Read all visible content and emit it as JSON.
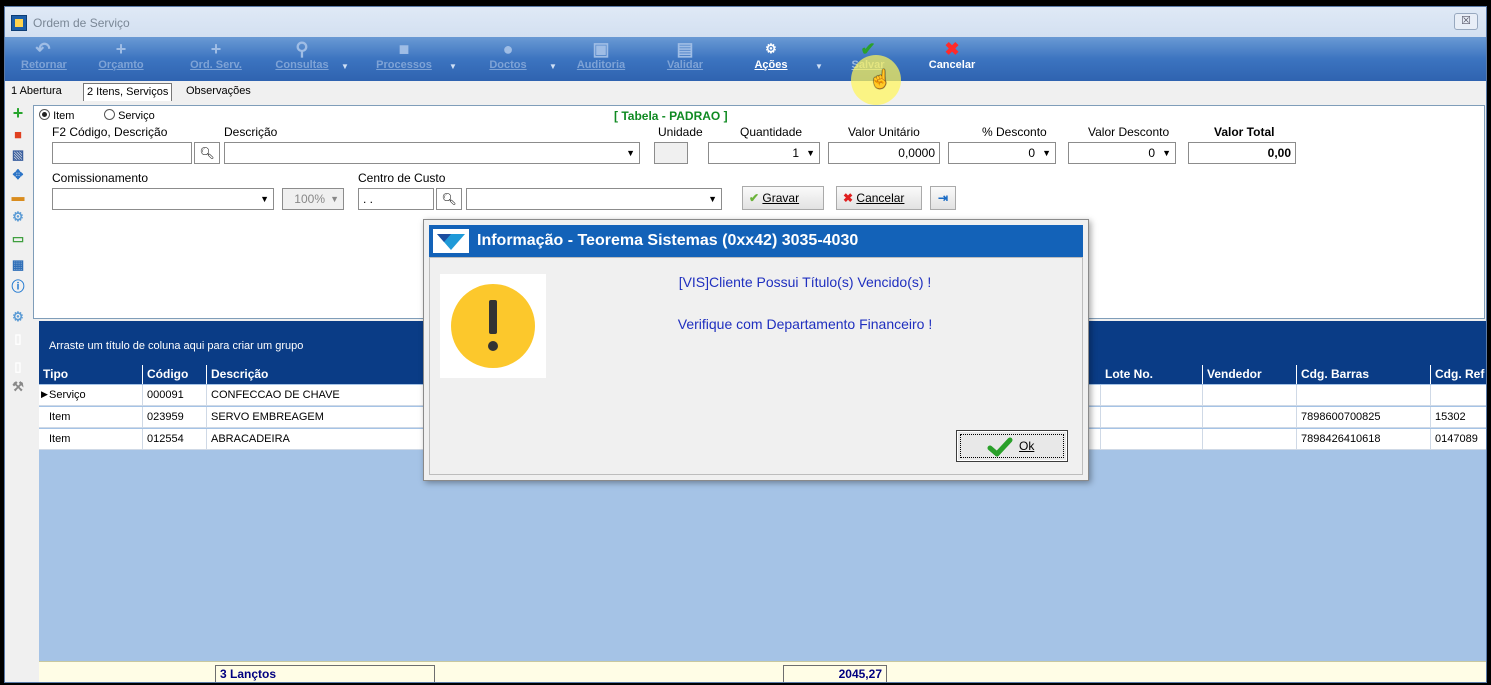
{
  "window": {
    "title": "Ordem de Serviço",
    "close_glyph": "☒"
  },
  "toolbar": {
    "items": [
      {
        "label": "Retornar",
        "icon": "undo-arrow-icon"
      },
      {
        "label": "Orçamto",
        "icon": "plus-icon"
      },
      {
        "label": "Ord. Serv.",
        "icon": "plus-icon"
      },
      {
        "label": "Consultas",
        "icon": "magnifier-icon"
      },
      {
        "label": "Processos",
        "icon": "gear-icon"
      },
      {
        "label": "Doctos",
        "icon": "document-icon"
      },
      {
        "label": "Auditoria",
        "icon": "audit-icon"
      },
      {
        "label": "Validar",
        "icon": "validate-icon"
      },
      {
        "label": "Ações",
        "icon": "actions-gear-icon"
      },
      {
        "label": "Salvar",
        "icon": "check-icon"
      },
      {
        "label": "Cancelar",
        "icon": "x-icon"
      }
    ]
  },
  "tabs": [
    "1 Abertura",
    "2 Itens, Serviços",
    "Observações"
  ],
  "form": {
    "radio_item": "Item",
    "radio_servico": "Serviço",
    "table_label": "[ Tabela - PADRAO ]",
    "lbl_codigo": "F2 Código, Descrição",
    "lbl_descricao": "Descrição",
    "lbl_unidade": "Unidade",
    "lbl_quantidade": "Quantidade",
    "lbl_valor_unitario": "Valor Unitário",
    "lbl_pct_desconto": "% Desconto",
    "lbl_valor_desconto": "Valor Desconto",
    "lbl_valor_total": "Valor Total",
    "quantidade": "1",
    "valor_unitario": "0,0000",
    "pct_desconto": "0",
    "valor_desconto": "0",
    "valor_total": "0,00",
    "lbl_comissionamento": "Comissionamento",
    "comissao_pct": "100%",
    "lbl_centro_custo": "Centro de Custo",
    "centro_custo_mask": ". .",
    "btn_gravar": "Gravar",
    "btn_cancelar": "Cancelar"
  },
  "grid": {
    "group_hint": "Arraste um título de coluna aqui para criar um grupo",
    "columns": [
      "Tipo",
      "Código",
      "Descrição",
      "Lote No.",
      "Vendedor",
      "Cdg. Barras",
      "Cdg. Ref"
    ],
    "rows": [
      {
        "tipo": "Serviço",
        "codigo": "000091",
        "descricao": "CONFECCAO DE CHAVE",
        "lote": "",
        "vendedor": "",
        "barras": "",
        "ref": ""
      },
      {
        "tipo": "Item",
        "codigo": "023959",
        "descricao": " SERVO EMBREAGEM",
        "lote": "",
        "vendedor": "",
        "barras": "7898600700825",
        "ref": "15302"
      },
      {
        "tipo": "Item",
        "codigo": "012554",
        "descricao": "ABRACADEIRA",
        "lote": "",
        "vendedor": "",
        "barras": "7898426410618",
        "ref": "0147089"
      }
    ],
    "footer_count": "3 Lançtos",
    "footer_total": "2045,27"
  },
  "dialog": {
    "title": "Informação - Teorema Sistemas (0xx42) 3035-4030",
    "message1": "[VIS]Cliente Possui Título(s) Vencido(s) !",
    "message2": "Verifique com Departamento Financeiro !",
    "ok_label": "Ok",
    "icon": "warning-icon",
    "accent": "#1362b8"
  }
}
